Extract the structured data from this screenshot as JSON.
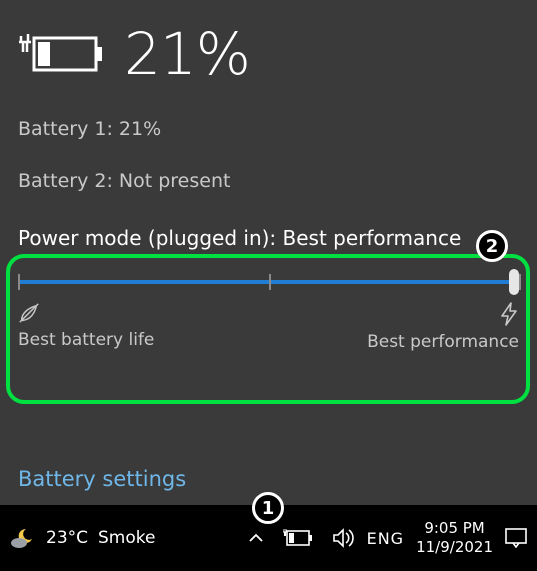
{
  "hero": {
    "percent": "21%"
  },
  "battery1": "Battery 1: 21%",
  "battery2": "Battery 2: Not present",
  "power": {
    "label": "Power mode (plugged in): Best performance",
    "slider": {
      "value": 100,
      "ticks": [
        0,
        50,
        100
      ]
    },
    "left_label": "Best battery life",
    "right_label": "Best performance"
  },
  "link": "Battery settings",
  "taskbar": {
    "weather_temp": "23°C",
    "weather_cond": "Smoke",
    "lang": "ENG",
    "time": "9:05 PM",
    "date": "11/9/2021"
  },
  "icons": {
    "battery_hero": "battery-charging-outline",
    "leaf": "leaf-eco",
    "bolt": "lightning",
    "weather": "moon-cloud",
    "chevron": "chevron-up",
    "tray_battery": "battery-charging-small",
    "volume": "volume",
    "action_center": "action-center"
  },
  "annotations": {
    "step1": "1",
    "step2": "2"
  },
  "colors": {
    "accent": "#1f7dd3",
    "highlight": "#00e040",
    "link": "#6fb7e8"
  }
}
